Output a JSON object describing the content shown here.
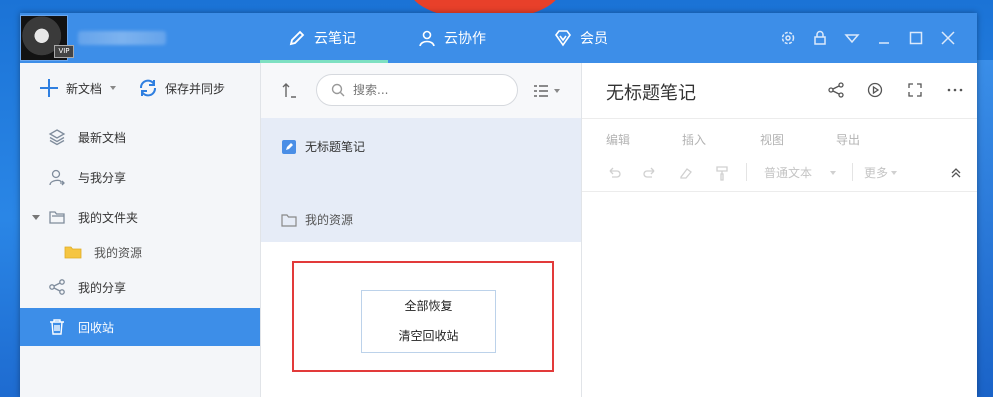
{
  "header": {
    "vip_badge": "VIP",
    "tabs": [
      {
        "label": "云笔记",
        "icon": "pen-icon",
        "active": true
      },
      {
        "label": "云协作",
        "icon": "user-icon"
      },
      {
        "label": "会员",
        "icon": "diamond-icon"
      }
    ],
    "window_controls": [
      "gear-icon",
      "lock-icon",
      "dropdown-icon",
      "minimize-icon",
      "maximize-icon",
      "close-icon"
    ]
  },
  "sidebar": {
    "new_doc": "新文档",
    "save_sync": "保存并同步",
    "items": [
      {
        "label": "最新文档",
        "icon": "layers-icon"
      },
      {
        "label": "与我分享",
        "icon": "user-share-icon"
      },
      {
        "label": "我的文件夹",
        "icon": "folder-icon"
      },
      {
        "label": "我的资源",
        "icon": "folder-yellow-icon"
      },
      {
        "label": "我的分享",
        "icon": "share-icon"
      },
      {
        "label": "回收站",
        "icon": "trash-icon",
        "active": true
      }
    ]
  },
  "list": {
    "search_placeholder": "搜索...",
    "notes": [
      {
        "label": "无标题笔记",
        "icon": "note-icon"
      },
      {
        "label": "我的资源",
        "icon": "folder-icon"
      }
    ],
    "context_menu": [
      "全部恢复",
      "清空回收站"
    ]
  },
  "editor": {
    "title": "无标题笔记",
    "menu": [
      "编辑",
      "插入",
      "视图",
      "导出"
    ],
    "style_select": "普通文本",
    "more": "更多"
  },
  "colors": {
    "accent": "#3d8ee8",
    "highlight": "#e23a3a",
    "active_tab_line": "#7ee0c2"
  }
}
